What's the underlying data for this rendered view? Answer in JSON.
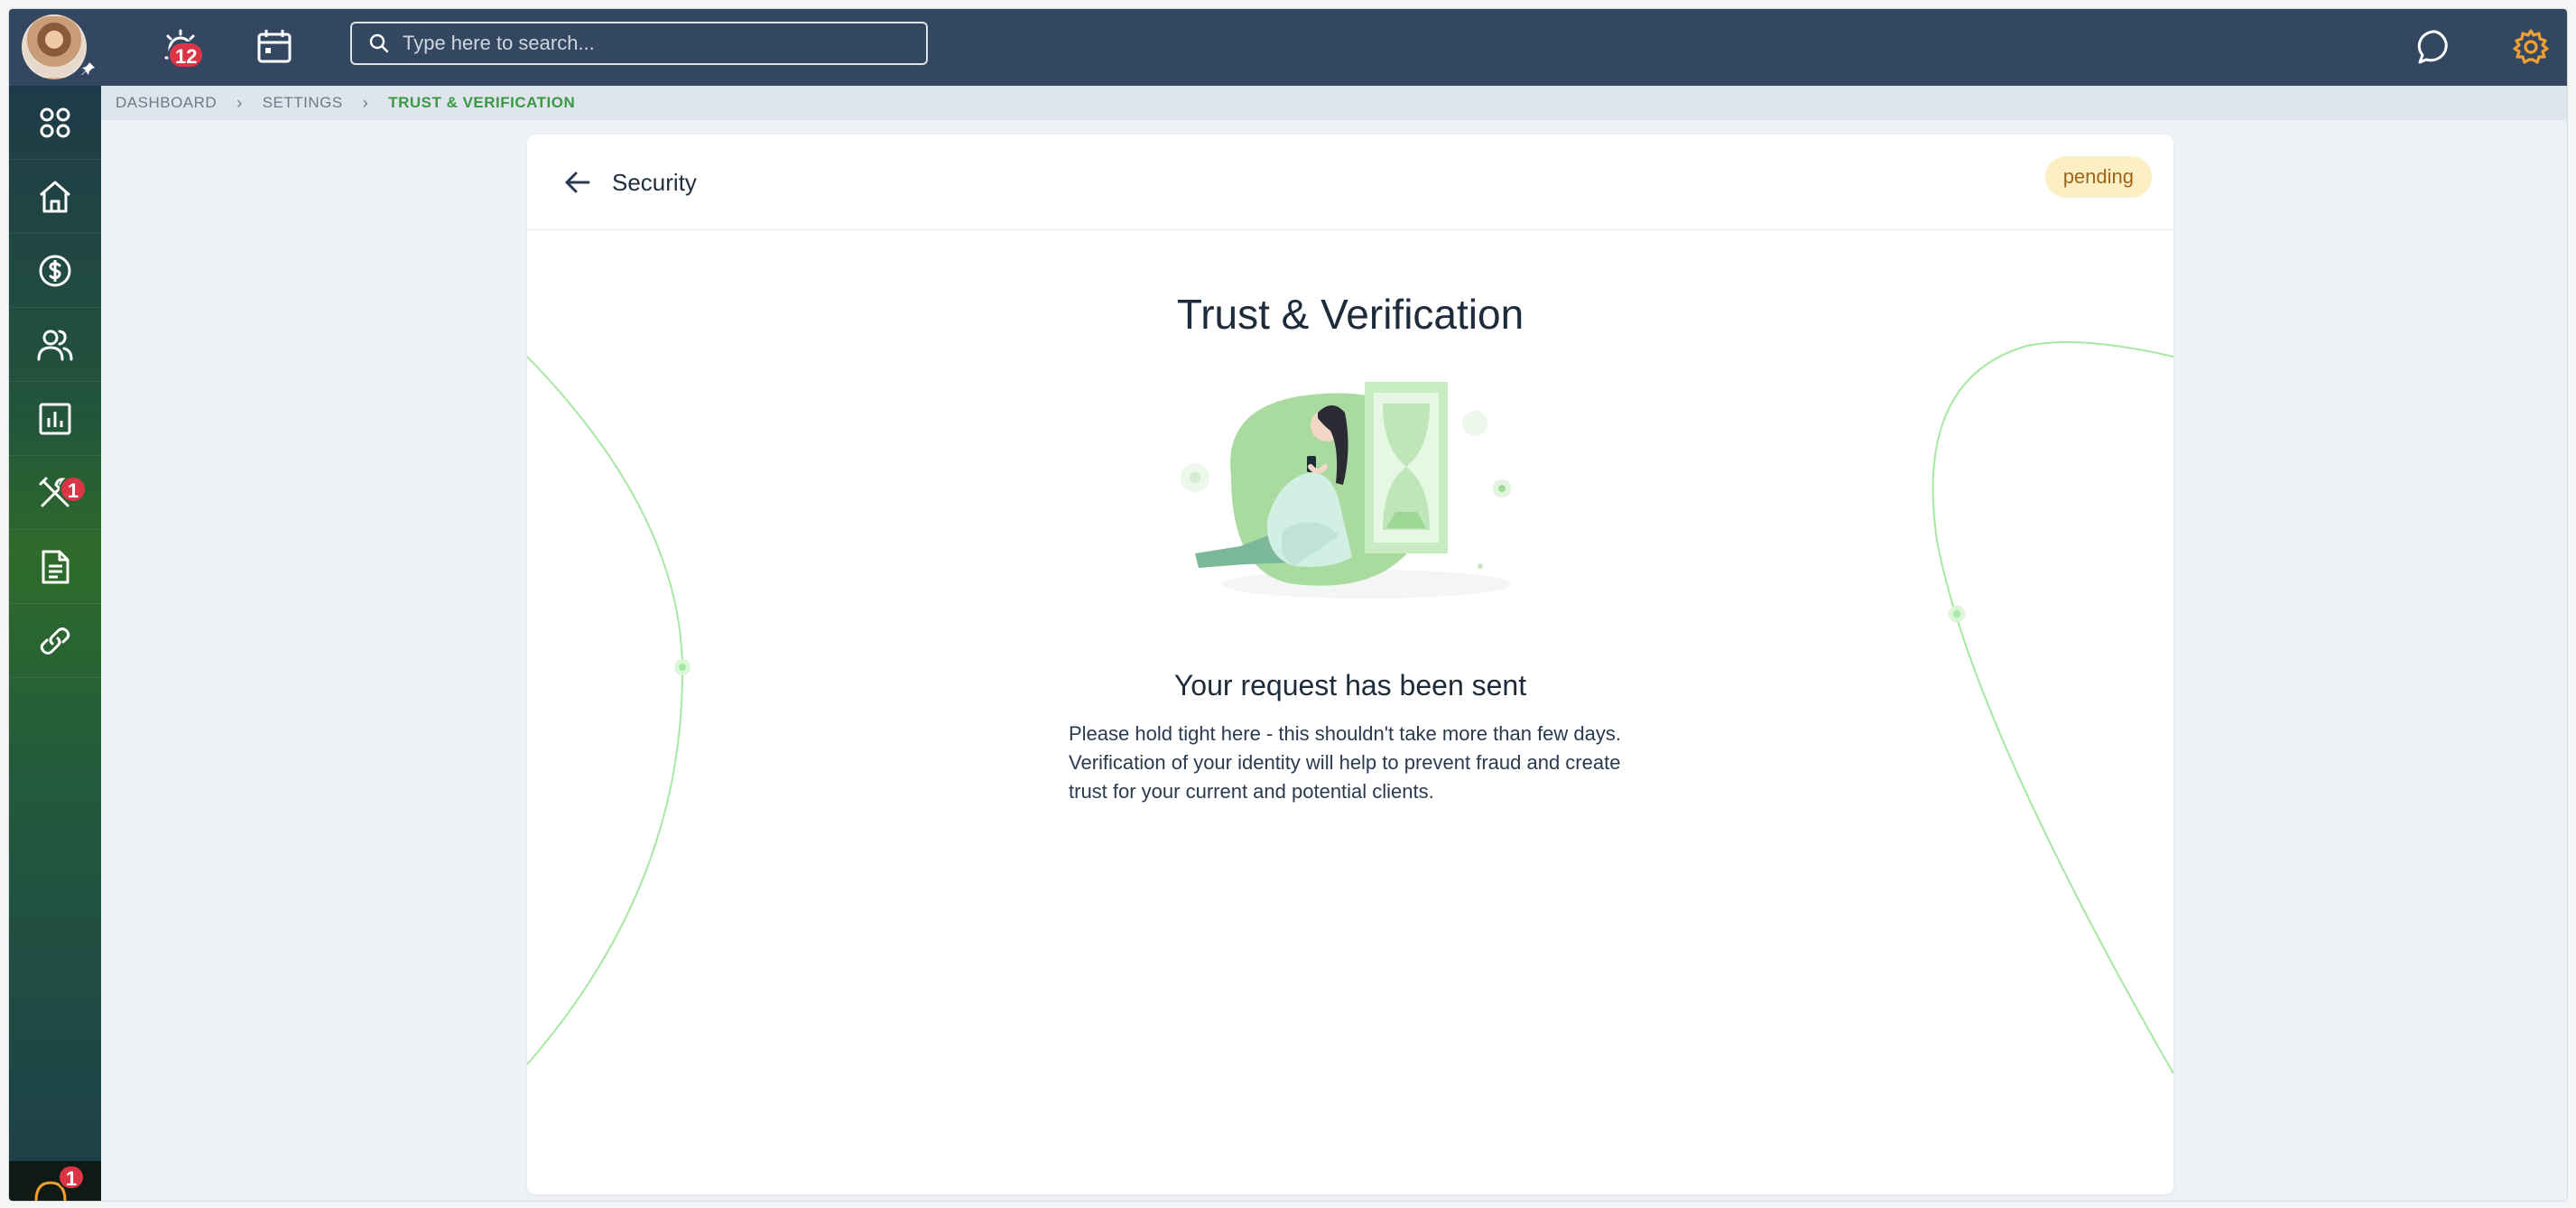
{
  "topbar": {
    "notifications_count": "12",
    "search_placeholder": "Type here to search..."
  },
  "sidebar": {
    "tools_badge": "1",
    "bottom_badge": "1"
  },
  "breadcrumb": {
    "items": [
      "DASHBOARD",
      "SETTINGS",
      "TRUST & VERIFICATION"
    ]
  },
  "card": {
    "header_title": "Security",
    "status": "pending",
    "title": "Trust & Verification",
    "subtitle": "Your request has been sent",
    "description": "Please hold tight here - this shouldn't take more than few days. Verification of your identity will help to prevent fraud and create trust for your current and potential clients."
  },
  "colors": {
    "topbar": "#344760",
    "accent_green": "#3a9a44",
    "pending_bg": "#fdefc4",
    "pending_text": "#a2641a",
    "badge_red": "#dc3545",
    "settings_icon": "#f0a030"
  }
}
